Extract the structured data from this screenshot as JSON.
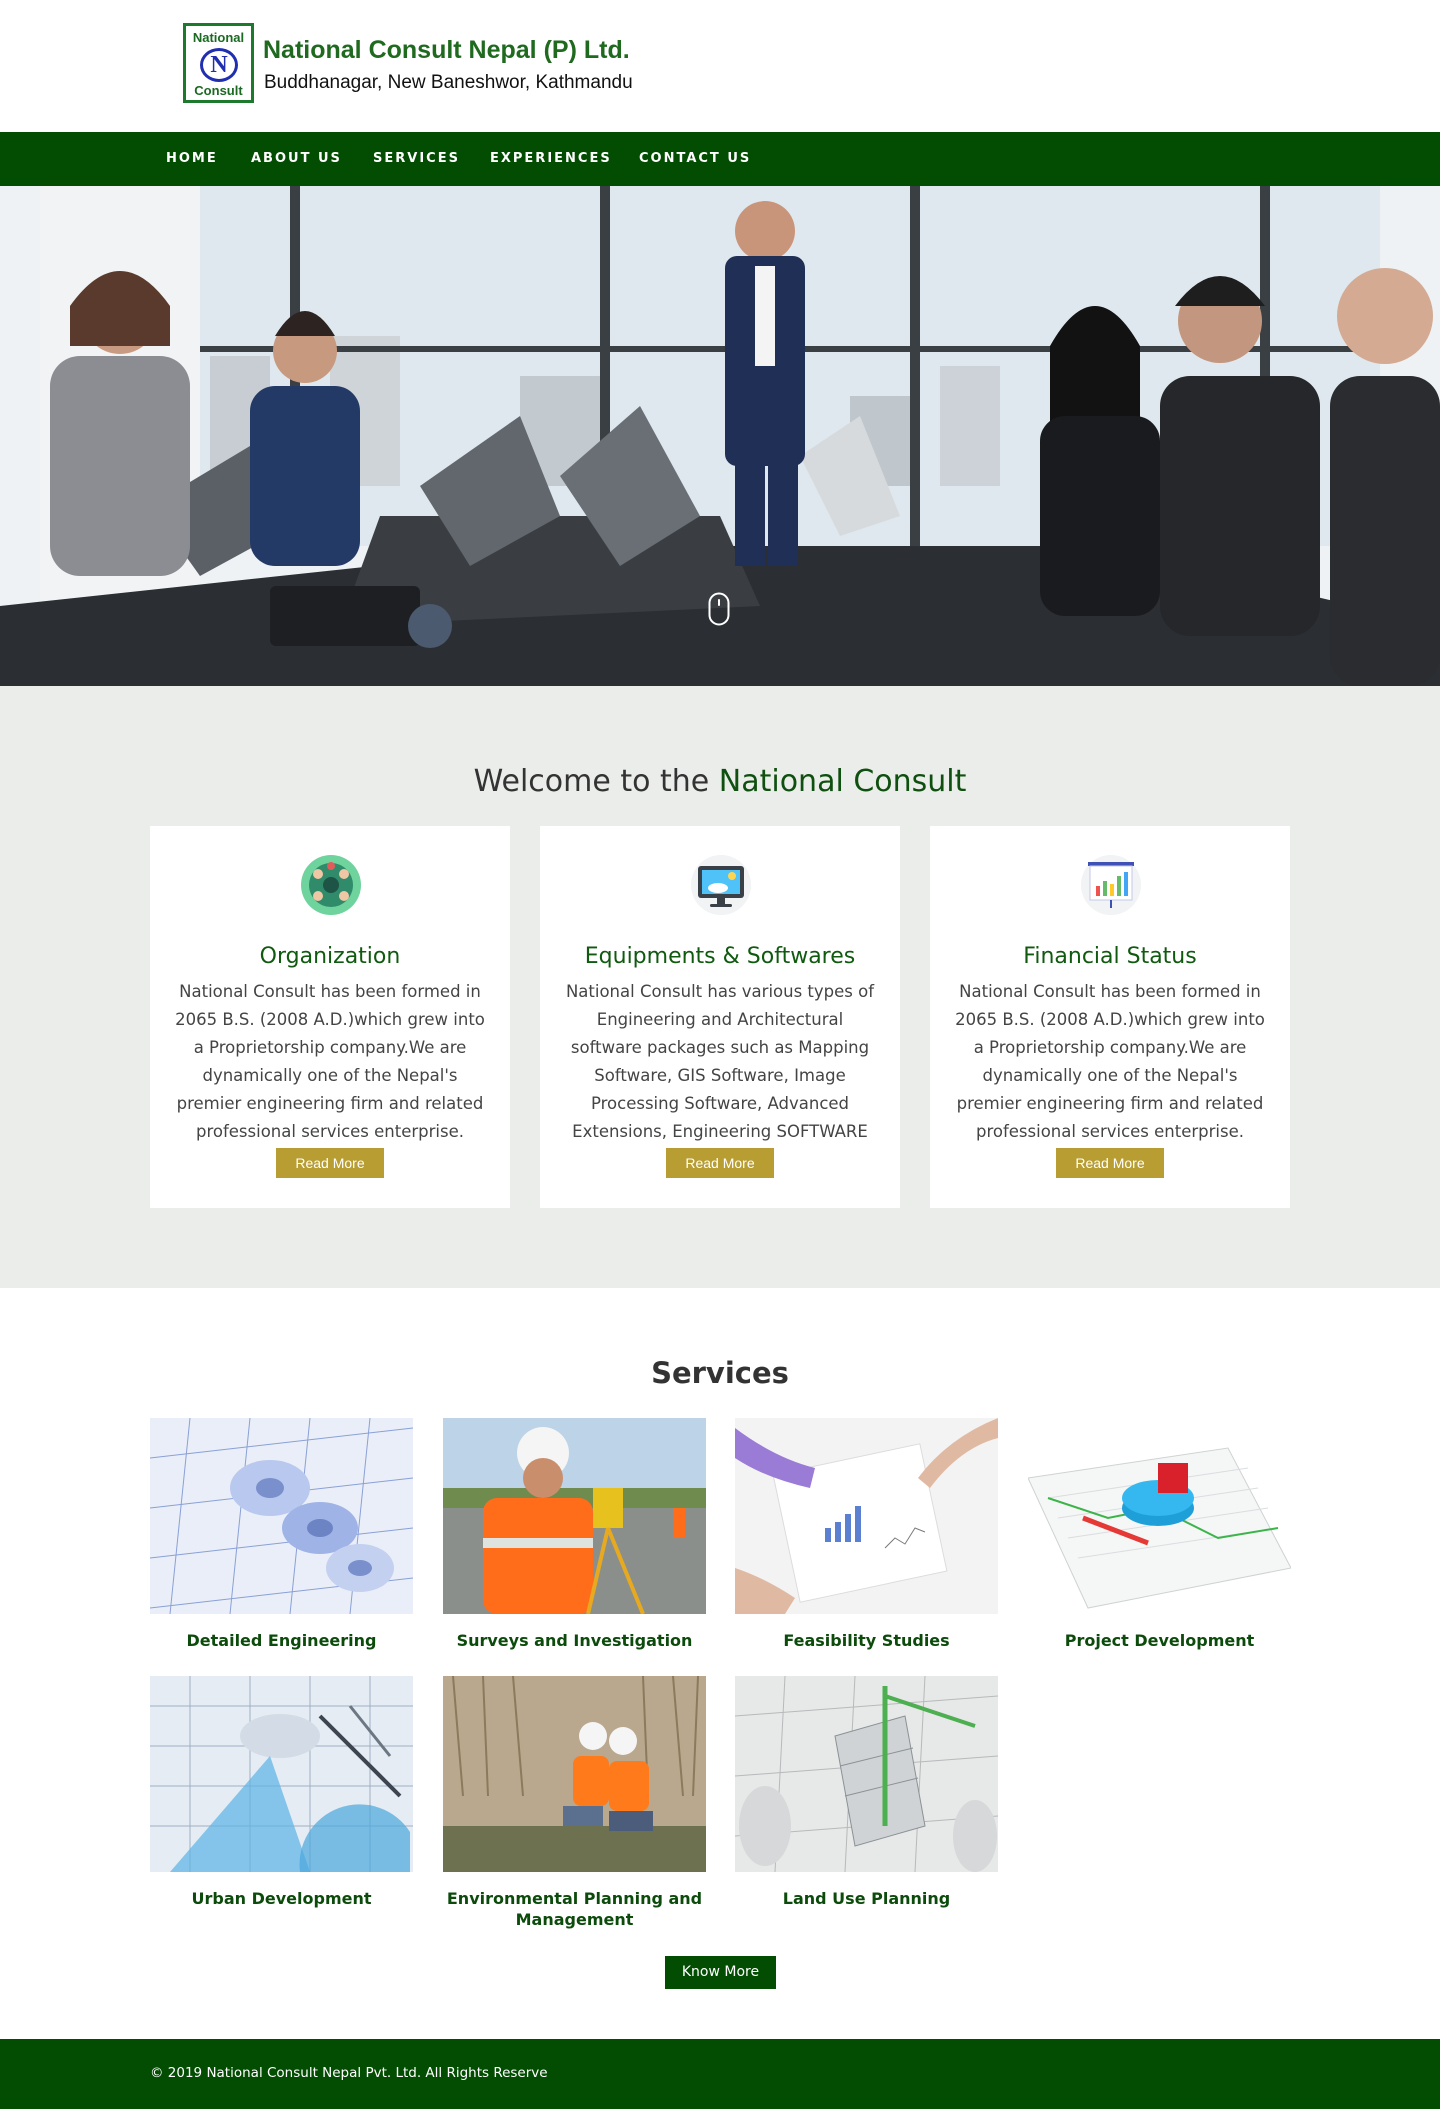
{
  "header": {
    "logo_top": "National",
    "logo_mark": "N",
    "logo_bottom": "Consult",
    "company_name": "National Consult Nepal (P) Ltd.",
    "address": "Buddhanagar, New Baneshwor, Kathmandu"
  },
  "nav": {
    "items": [
      {
        "label": "HOME"
      },
      {
        "label": "ABOUT US"
      },
      {
        "label": "SERVICES"
      },
      {
        "label": "EXPERIENCES"
      },
      {
        "label": "CONTACT US"
      }
    ]
  },
  "hero": {
    "image": "business-meeting-photo",
    "scroll_icon": "mouse-scroll-icon"
  },
  "welcome": {
    "title_prefix": "Welcome to the ",
    "title_highlight": "National Consult",
    "cards": [
      {
        "icon": "organization-icon",
        "title": "Organization",
        "text": "National Consult has been formed in 2065 B.S. (2008 A.D.)which grew into a Proprietorship company.We are dynamically one of the Nepal's premier engineering firm and related professional services enterprise.",
        "button": "Read More"
      },
      {
        "icon": "monitor-icon",
        "title": "Equipments & Softwares",
        "text": "National Consult has various types of Engineering and Architectural software packages such as Mapping Software, GIS Software, Image Processing Software, Advanced Extensions, Engineering SOFTWARE and so on.",
        "button": "Read More"
      },
      {
        "icon": "bar-chart-board-icon",
        "title": "Financial Status",
        "text": "National Consult has been formed in 2065 B.S. (2008 A.D.)which grew into a Proprietorship company.We are dynamically one of the Nepal's premier engineering firm and related professional services enterprise.",
        "button": "Read More"
      }
    ]
  },
  "services": {
    "title": "Services",
    "items": [
      {
        "label": "Detailed Engineering"
      },
      {
        "label": "Surveys and Investigation"
      },
      {
        "label": "Feasibility Studies"
      },
      {
        "label": "Project Development"
      },
      {
        "label": "Urban Development"
      },
      {
        "label": "Environmental Planning and Management"
      },
      {
        "label": "Land Use Planning"
      }
    ],
    "button": "Know More"
  },
  "footer": {
    "copyright": "© 2019 National Consult Nepal Pvt. Ltd. All Rights Reserve"
  },
  "colors": {
    "brand_green": "#024d02",
    "accent_gold": "#b89e32",
    "section_bg": "#ebedea"
  }
}
